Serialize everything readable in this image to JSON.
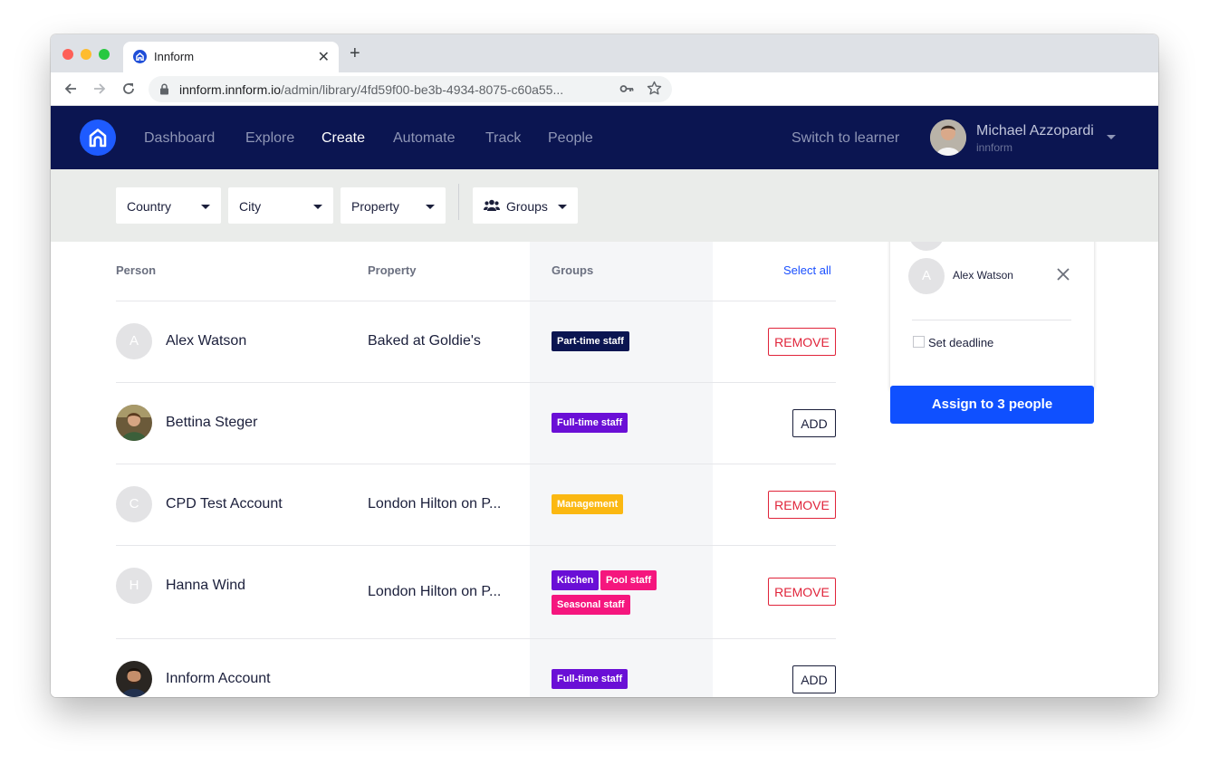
{
  "browser": {
    "tab_title": "Innform",
    "url_host": "innform.innform.io",
    "url_path": "/admin/library/4fd59f00-be3b-4934-8075-c60a55..."
  },
  "appbar": {
    "nav": [
      "Dashboard",
      "Explore",
      "Create",
      "Automate",
      "Track",
      "People"
    ],
    "active_nav": "Create",
    "switch_label": "Switch to learner",
    "user_name": "Michael Azzopardi",
    "user_org": "innform"
  },
  "filters": {
    "country": "Country",
    "city": "City",
    "property": "Property",
    "groups": "Groups"
  },
  "table": {
    "headers": {
      "person": "Person",
      "property": "Property",
      "groups": "Groups",
      "select_all": "Select all"
    },
    "rows": [
      {
        "name": "Alex Watson",
        "initial": "A",
        "property": "Baked at Goldie's",
        "tags": [
          {
            "label": "Part-time staff",
            "color": "#0b1551"
          }
        ],
        "action": "REMOVE"
      },
      {
        "name": "Bettina Steger",
        "initial": "",
        "property": "",
        "tags": [
          {
            "label": "Full-time staff",
            "color": "#6a0fd6"
          }
        ],
        "action": "ADD"
      },
      {
        "name": "CPD Test Account",
        "initial": "C",
        "property": "London Hilton on P...",
        "tags": [
          {
            "label": "Management",
            "color": "#fbb812"
          }
        ],
        "action": "REMOVE"
      },
      {
        "name": "Hanna Wind",
        "initial": "H",
        "property": "London Hilton on P...",
        "tags": [
          {
            "label": "Kitchen",
            "color": "#6a0fd6"
          },
          {
            "label": "Pool staff",
            "color": "#f5167e"
          },
          {
            "label": "Seasonal staff",
            "color": "#f5167e"
          }
        ],
        "action": "REMOVE"
      },
      {
        "name": "Innform Account",
        "initial": "",
        "property": "",
        "tags": [
          {
            "label": "Full-time staff",
            "color": "#6a0fd6"
          }
        ],
        "action": "ADD"
      }
    ]
  },
  "side_panel": {
    "selected_name": "Alex Watson",
    "selected_initial": "A",
    "deadline_label": "Set deadline",
    "assign_label": "Assign to 3 people"
  }
}
